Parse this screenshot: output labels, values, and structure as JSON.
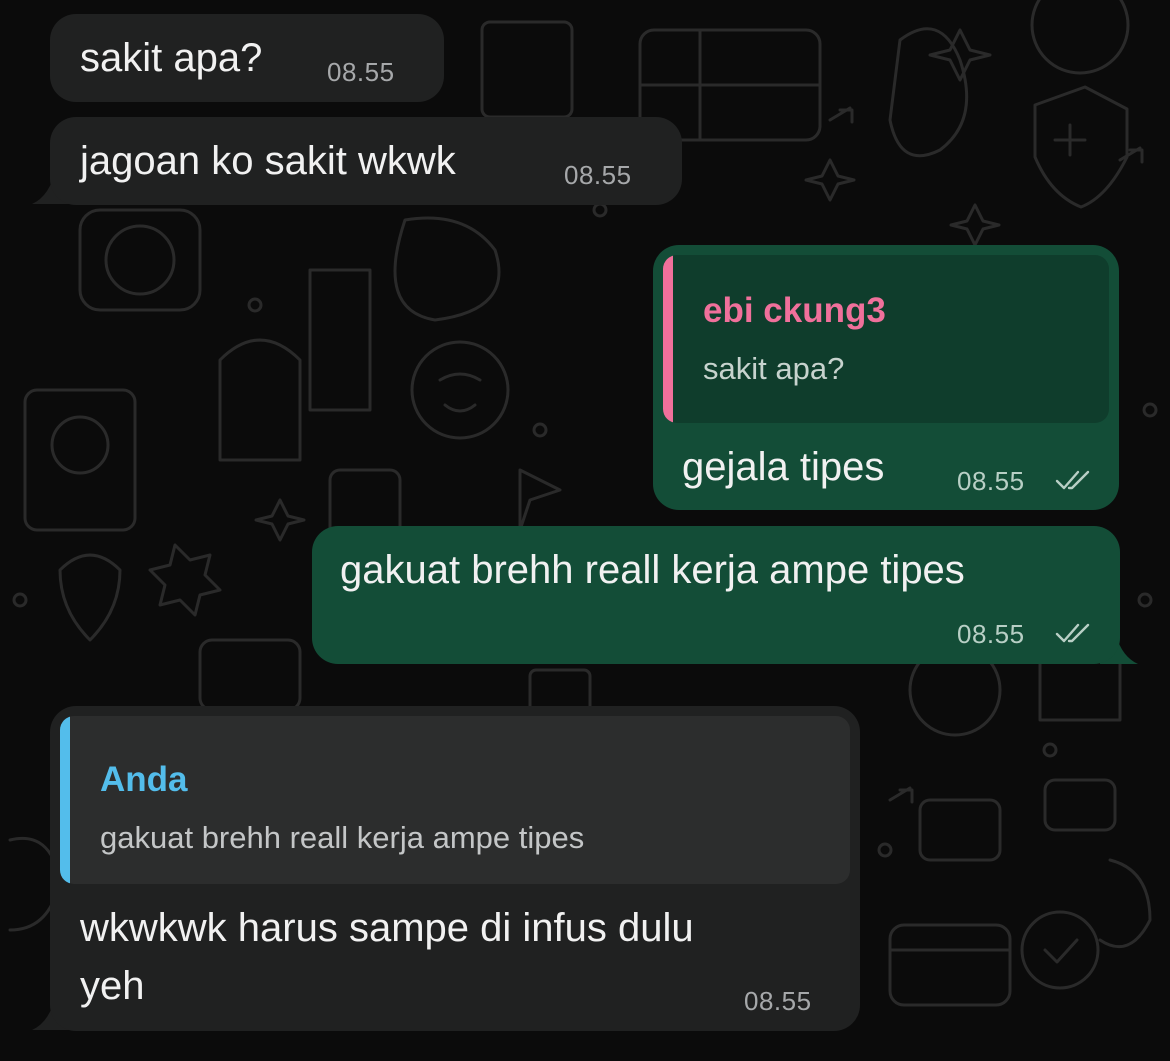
{
  "messages": [
    {
      "direction": "incoming",
      "text": "sakit apa?",
      "time": "08.55"
    },
    {
      "direction": "incoming",
      "text": "jagoan ko sakit wkwk",
      "time": "08.55"
    },
    {
      "direction": "outgoing",
      "quote": {
        "author": "ebi ckung3",
        "text": "sakit apa?"
      },
      "text": "gejala tipes",
      "time": "08.55",
      "read_status": "double-check-icon"
    },
    {
      "direction": "outgoing",
      "text": "gakuat brehh reall kerja ampe tipes",
      "time": "08.55",
      "read_status": "double-check-icon"
    },
    {
      "direction": "incoming",
      "quote": {
        "author": "Anda",
        "text": "gakuat brehh reall kerja ampe tipes"
      },
      "text_line1": "wkwkwk harus sampe di infus dulu",
      "text_line2": "yeh",
      "time": "08.55"
    }
  ],
  "colors": {
    "background": "#0b0b0b",
    "incoming_bubble": "#202121",
    "outgoing_bubble": "#134d37",
    "quote_pink": "#f0709b",
    "quote_blue": "#53bdeb"
  }
}
